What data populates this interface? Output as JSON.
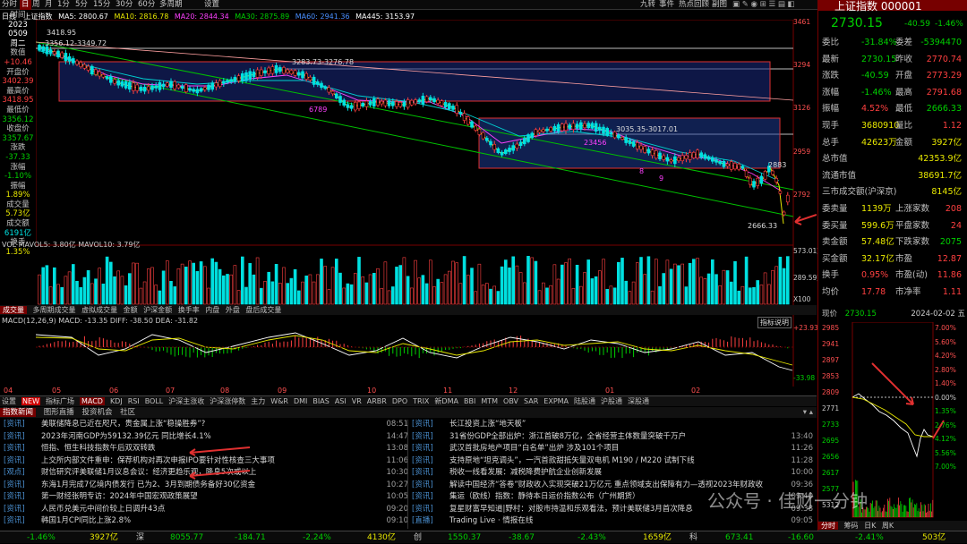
{
  "topbar": {
    "left": [
      "分时",
      "日",
      "周",
      "月",
      "1分",
      "5分",
      "15分",
      "30分",
      "60分",
      "多周期",
      "设置"
    ],
    "right": [
      "九转",
      "事件",
      "热点回顾",
      "副图"
    ]
  },
  "chart_header": {
    "period": "日线",
    "name": "上证指数",
    "ma5": "MA5: 2800.67",
    "ma10": "MA10: 2816.78",
    "ma20": "MA20: 2844.34",
    "ma30": "MA30: 2875.89",
    "ma60": "MA60: 2941.36",
    "ma445": "MA445: 3153.97"
  },
  "left_panel": {
    "time_label": "时间",
    "date1": "2023",
    "date2": "0509",
    "weekday": "周二",
    "value_label": "数值",
    "value": "+10.46",
    "open_label": "开盘价",
    "open": "3402.39",
    "high_label": "最高价",
    "high": "3418.95",
    "low_label": "最低价",
    "low": "3356.12",
    "close_label": "收盘价",
    "close": "3357.67",
    "change_label": "涨跌",
    "change": "-37.33",
    "pct_label": "涨幅",
    "pct": "-1.10%",
    "amp_label": "振幅",
    "amp": "1.89%",
    "vol_label": "成交量",
    "vol": "5.73亿",
    "amt_label": "成交额",
    "amt": "6191亿",
    "turn_label": "换手",
    "turn": "1.35%"
  },
  "price_axis": [
    "3461",
    "3294",
    "3126",
    "2959",
    "2792"
  ],
  "annotations": {
    "high1": "3418.95",
    "a1": "3356.12-3349.72",
    "a2": "3283.73-3276.78",
    "a3": "3035.35-3017.01",
    "a4": "2883",
    "low": "2666.33",
    "n1": "6789",
    "n2": "23456",
    "n3": "8",
    "n4": "9"
  },
  "volume": {
    "header": "VOL  MAVOL5: 3.80亿  MAVOL10: 3.79亿",
    "axis_top": "573.01万",
    "axis_mid": "289.59万",
    "axis_unit": "X100"
  },
  "vol_tabs": [
    "成交量",
    "多周期成交量",
    "虚拟成交量",
    "金额",
    "沪深金额",
    "换手率",
    "内盘",
    "外盘",
    "盘后成交量"
  ],
  "macd": {
    "header": "MACD(12,26,9)  MACD: -13.35  DIFF: -38.50  DEA: -31.82",
    "button": "指标说明",
    "axis_top": "+23.93",
    "axis_bottom": "-33.98"
  },
  "months": [
    "04",
    "05",
    "06",
    "07",
    "08",
    "09",
    "10",
    "11",
    "12",
    "01",
    "02"
  ],
  "indicator_tabs": [
    "设置",
    "NEW",
    "指标广场",
    "MACD",
    "KDJ",
    "RSI",
    "BOLL",
    "沪深主涨收",
    "沪深涨停数",
    "主力",
    "W&R",
    "DMI",
    "BIAS",
    "ASI",
    "VR",
    "ARBR",
    "DPO",
    "TRIX",
    "新DMA",
    "BBI",
    "MTM",
    "OBV",
    "SAR",
    "EXPMA",
    "陆股通",
    "沪股通",
    "深股通"
  ],
  "news_tabs": [
    "指数新闻",
    "图形直播",
    "投资机会",
    "社区"
  ],
  "news_left": [
    {
      "tag": "[资讯]",
      "text": "美联储降息已近在咫尺，贵金属上涨“稳操胜券”?",
      "time": "08:51"
    },
    {
      "tag": "[资讯]",
      "text": "2023年河南GDP为59132.39亿元 同比增长4.1%",
      "time": "14:47"
    },
    {
      "tag": "[资讯]",
      "text": "恒指、恒生科技指数午后双双转跌",
      "time": "13:08"
    },
    {
      "tag": "[资讯]",
      "text": "上交所内部文件重申：保荐机构对再次申报IPO要针对性核查三大事项",
      "time": "11:06"
    },
    {
      "tag": "[观点]",
      "text": "财信研究评美联储1月议息会议：经济更趋乐观，降息5次或以上",
      "time": "10:30"
    },
    {
      "tag": "[资讯]",
      "text": "东海1月完成7亿境内债发行 已为2、3月到期债务备好30亿资金",
      "time": "10:27"
    },
    {
      "tag": "[资讯]",
      "text": "第一财经张明专访：2024年中国宏观政策展望",
      "time": "10:05"
    },
    {
      "tag": "[资讯]",
      "text": "人民币兑美元中间价较上日调升43点",
      "time": "09:20"
    },
    {
      "tag": "[资讯]",
      "text": "韩国1月CPI同比上涨2.8%",
      "time": "09:10"
    }
  ],
  "news_right": [
    {
      "tag": "[资讯]",
      "text": "长江投资上涨“地天板”",
      "time": ""
    },
    {
      "tag": "[资讯]",
      "text": "31省份GDP全部出炉：浙江首破8万亿，全省经营主体数量突破千万户",
      "time": "13:40"
    },
    {
      "tag": "[资讯]",
      "text": "武汉首批房地产项目“白名单”出炉 涉及101个项目",
      "time": "11:26"
    },
    {
      "tag": "[资讯]",
      "text": "支持原地“坦克调头”，一汽首款甜抵矢量双电机 M190 / M220 试制下线",
      "time": "11:28"
    },
    {
      "tag": "[资讯]",
      "text": "税收一线看发展：减税降费护航企业创新发展",
      "time": "10:00"
    },
    {
      "tag": "[资讯]",
      "text": "解读中国经济“答卷”财政收入实现突破21万亿元 重点领域支出保障有力—透视2023年财政收",
      "time": "09:36"
    },
    {
      "tag": "[资讯]",
      "text": "集运（欧线）指数：静待本日运价指数公布（广州期货）",
      "time": "09:40"
    },
    {
      "tag": "[资讯]",
      "text": "复星财富早知道|野村：对股市持温和乐观看法，预计美联储3月首次降息",
      "time": "09:38"
    },
    {
      "tag": "[直播]",
      "text": "Trading Live · 情报在线",
      "time": "09:05"
    }
  ],
  "quote": {
    "name": "上证指数 000001",
    "price": "2730.15",
    "change": "-40.59",
    "pct": "-1.46%",
    "rows": [
      [
        "委比",
        "-31.84%",
        "委差",
        "-5394470"
      ],
      [
        "最新",
        "2730.15",
        "昨收",
        "2770.74"
      ],
      [
        "涨跌",
        "-40.59",
        "开盘",
        "2773.29"
      ],
      [
        "涨幅",
        "-1.46%",
        "最高",
        "2791.68"
      ],
      [
        "振幅",
        "4.52%",
        "最低",
        "2666.33"
      ],
      [
        "现手",
        "3680910",
        "量比",
        "1.12"
      ],
      [
        "总手",
        "42623万",
        "金额",
        "3927亿"
      ],
      [
        "总市值",
        "",
        "",
        "42353.9亿"
      ],
      [
        "流通市值",
        "",
        "",
        "38691.7亿"
      ],
      [
        "三市成交额(沪深京)",
        "",
        "",
        "8145亿"
      ],
      [
        "委卖量",
        "1139万",
        "上涨家数",
        "208"
      ],
      [
        "委买量",
        "599.6万",
        "平盘家数",
        "24"
      ],
      [
        "卖金额",
        "57.48亿",
        "下跌家数",
        "2075"
      ],
      [
        "买金额",
        "32.17亿",
        "市盈",
        "12.87"
      ],
      [
        "换手",
        "0.95%",
        "市盈(动)",
        "11.86"
      ],
      [
        "均价",
        "17.78",
        "市净率",
        "1.11"
      ]
    ],
    "intraday_label": "现价",
    "intraday_price": "2730.15",
    "intraday_date": "2024-02-02 五",
    "intraday_axis_left": [
      "2985",
      "2941",
      "2897",
      "2853",
      "2809",
      "2771",
      "2733",
      "2695",
      "2656",
      "2617",
      "2577",
      "5312"
    ],
    "intraday_axis_right": [
      "7.00%",
      "5.60%",
      "4.20%",
      "2.80%",
      "1.40%",
      "0.00%",
      "1.35%",
      "2.76%",
      "4.12%",
      "5.56%",
      "7.00%"
    ],
    "intraday_tabs": [
      "分时",
      "筹码",
      "日K",
      "周K"
    ]
  },
  "status": {
    "pct": "-1.46%",
    "amt": "3927亿",
    "mkt2": "深",
    "v2": "8055.77",
    "c2": "-184.71",
    "p2": "-2.24%",
    "a2": "4130亿",
    "mkt3": "创",
    "v3": "1550.37",
    "c3": "-38.67",
    "p3": "-2.43%",
    "a3": "1659亿",
    "mkt4": "科",
    "v4": "673.41",
    "c4": "-16.60",
    "p4": "-2.41%",
    "a4": "503亿"
  },
  "watermark": "公众号 · 佳财一分钟"
}
